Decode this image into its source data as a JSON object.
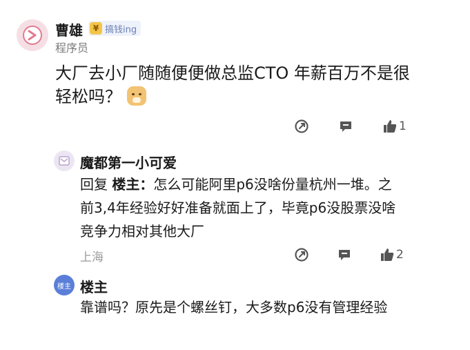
{
  "main_comment": {
    "author": "曹雄",
    "badge_icon_text": "¥",
    "badge": "搞钱ing",
    "role": "程序员",
    "content": "大厂去小厂随随便便做总监CTO  年薪百万不是很轻松吗？",
    "emoji": "dog-face-icon",
    "like_count": "1"
  },
  "reply1": {
    "author": "魔都第一小可爱",
    "reply_prefix": "回复 ",
    "reply_target": "楼主：",
    "content": "怎么可能阿里p6没啥份量杭州一堆。之前3,4年经验好好准备就面上了，毕竟p6没股票没啥竞争力相对其他大厂",
    "location": "上海",
    "like_count": "2"
  },
  "reply2": {
    "avatar_text": "楼主",
    "author": "楼主",
    "content": "靠谱吗？原先是个螺丝钉，大多数p6没有管理经验"
  },
  "icons": {
    "share": "share-icon",
    "comment": "comment-icon",
    "like": "thumbs-up-icon"
  },
  "colors": {
    "text": "#1a1a1a",
    "muted": "#9a9a9a",
    "badge_bg": "#eef2fb",
    "badge_text": "#6a7fb3",
    "op_avatar": "#5b7fd8"
  }
}
